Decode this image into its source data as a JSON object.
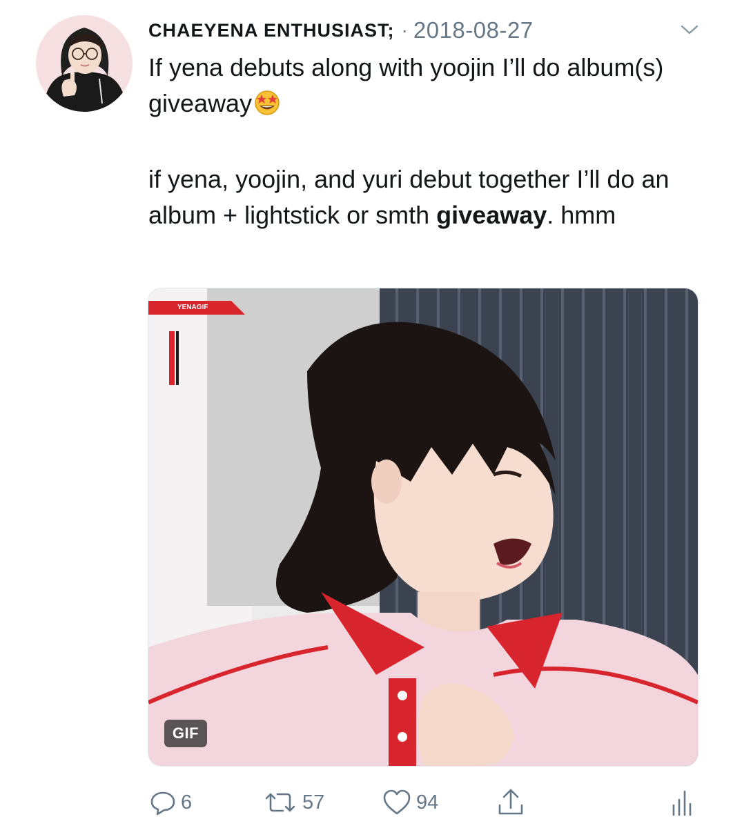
{
  "tweet": {
    "display_name": "CHAEYENA ENTHUSIAST;",
    "separator": "·",
    "date": "2018-08-27",
    "paragraph1": "If yena debuts along with yoojin I’ll do album(s) giveaway",
    "paragraph1_emoji": "star-struck-emoji",
    "paragraph2_text": "if yena, yoojin, and yuri debut together I’ll do an album + lightstick or smth ",
    "paragraph2_bold": "giveaway",
    "paragraph2_tail": ". hmm"
  },
  "media": {
    "watermark": "YENAGIF",
    "badge": "GIF"
  },
  "actions": {
    "reply_count": "6",
    "retweet_count": "57",
    "like_count": "94"
  },
  "icons": {
    "reply": "reply-icon",
    "retweet": "retweet-icon",
    "like": "heart-icon",
    "share": "share-icon",
    "stats": "analytics-icon",
    "menu": "chevron-down-icon"
  },
  "colors": {
    "text": "#14171a",
    "secondary": "#657786",
    "border": "#e1e8ed"
  }
}
